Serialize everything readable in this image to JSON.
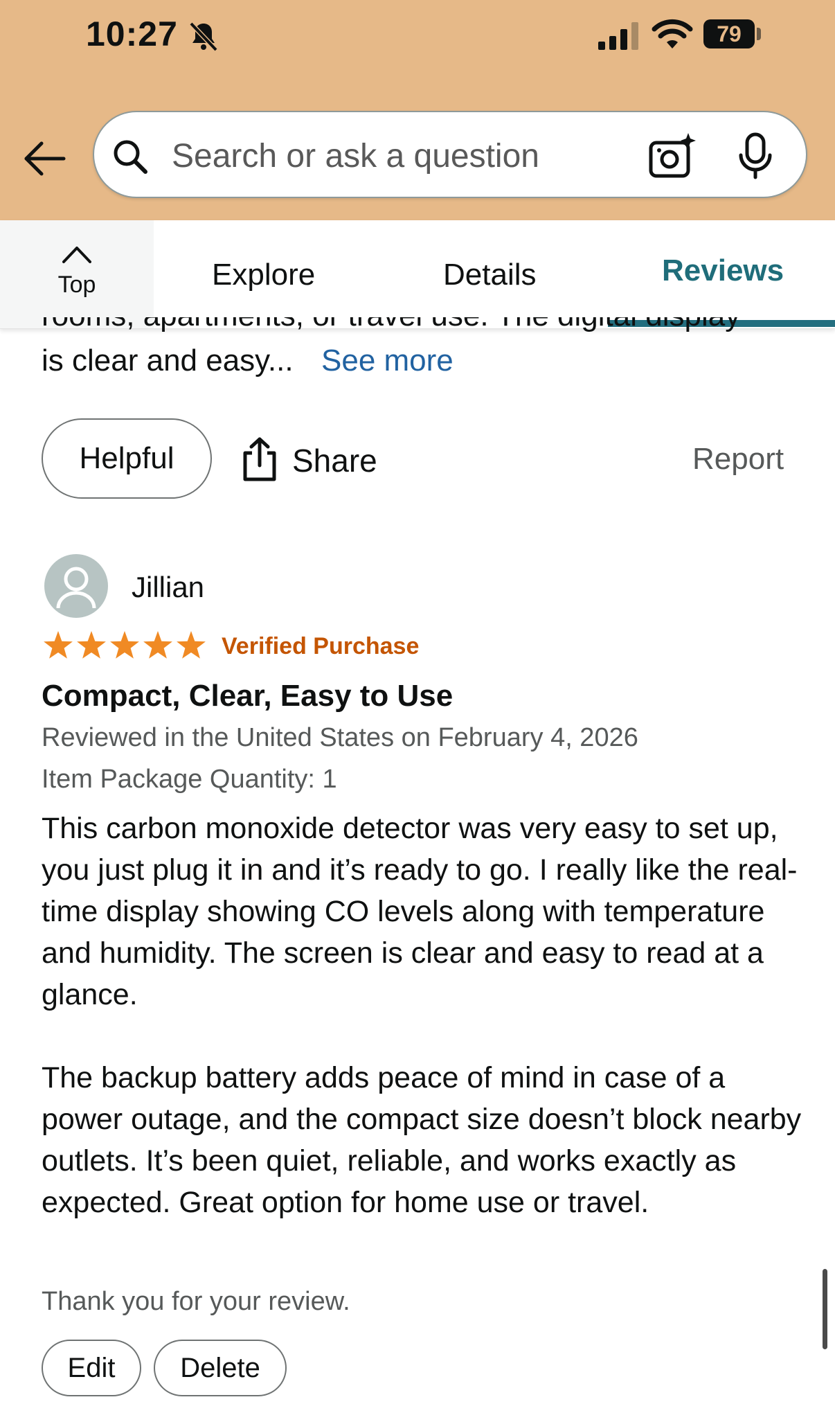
{
  "status_bar": {
    "time": "10:27",
    "battery": "79",
    "icons": [
      "bell-off-icon",
      "signal-icon",
      "wifi-icon",
      "battery-icon"
    ]
  },
  "search": {
    "placeholder": "Search or ask a question",
    "icons": [
      "back-icon",
      "search-icon",
      "camera-icon",
      "mic-icon"
    ]
  },
  "tabs": {
    "top_label": "Top",
    "items": [
      {
        "label": "Explore"
      },
      {
        "label": "Details"
      },
      {
        "label": "Reviews",
        "active": true
      }
    ]
  },
  "previous_review": {
    "clipped_line": "rooms, apartments, or travel use. The digital display",
    "text": "is clear and easy...",
    "see_more": "See more",
    "helpful": "Helpful",
    "share": "Share",
    "report": "Report"
  },
  "review": {
    "reviewer": "Jillian",
    "rating": 5,
    "rating_max": 5,
    "verified": "Verified Purchase",
    "title": "Compact, Clear, Easy to Use",
    "date": "Reviewed in the United States on February 4, 2026",
    "quantity": "Item Package Quantity: 1",
    "body": [
      "This carbon monoxide detector was very easy to set up, you just plug it in and it’s ready to go. I really like the real-time display showing CO levels along with temperature and humidity. The screen is clear and easy to read at a glance.",
      "The backup battery adds peace of mind in case of a power outage, and the compact size doesn’t block nearby outlets. It’s been quiet, reliable, and works exactly as expected. Great option for home use or travel."
    ],
    "thanks": "Thank you for your review.",
    "edit": "Edit",
    "delete": "Delete"
  },
  "colors": {
    "header_bg": "#e6b988",
    "active_tab": "#1f6d7a",
    "link": "#2162a1",
    "verified": "#c45500",
    "star": "#f08a24"
  }
}
